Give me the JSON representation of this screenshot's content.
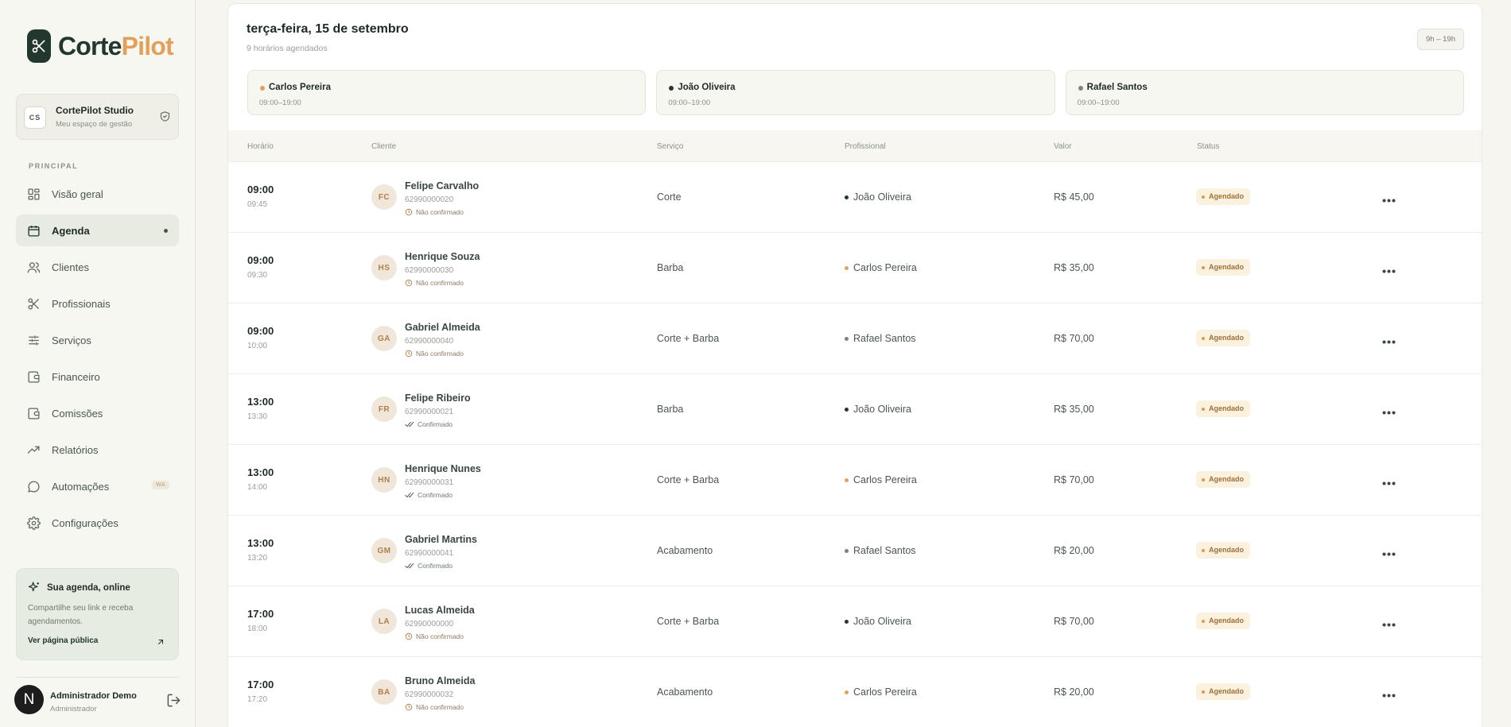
{
  "brand": {
    "name_a": "Corte",
    "name_b": "Pilot",
    "accent": "#e3a05b",
    "dark": "#22382e"
  },
  "studio": {
    "initials": "CS",
    "name": "CortePilot Studio",
    "subtitle": "Meu espaço de gestão"
  },
  "sidebar": {
    "section": "PRINCIPAL",
    "items": [
      {
        "label": "Visão geral",
        "icon": "grid-icon"
      },
      {
        "label": "Agenda",
        "icon": "calendar-icon",
        "active": true
      },
      {
        "label": "Clientes",
        "icon": "users-icon"
      },
      {
        "label": "Profissionais",
        "icon": "scissors-icon"
      },
      {
        "label": "Serviços",
        "icon": "sliders-icon"
      },
      {
        "label": "Financeiro",
        "icon": "wallet-icon"
      },
      {
        "label": "Comissões",
        "icon": "wallet-icon"
      },
      {
        "label": "Relatórios",
        "icon": "trend-icon"
      },
      {
        "label": "Automações",
        "icon": "chat-icon",
        "badge": "WA"
      },
      {
        "label": "Configurações",
        "icon": "gear-icon"
      }
    ]
  },
  "promo": {
    "title": "Sua agenda, online",
    "text": "Compartilhe seu link e receba agendamentos.",
    "link": "Ver página pública"
  },
  "user": {
    "initial": "N",
    "name": "Administrador Demo",
    "role": "Administrador"
  },
  "day": {
    "title": "terça-feira, 15 de setembro",
    "subtitle": "9 horários agendados",
    "hours": "9h – 19h"
  },
  "professionals": [
    {
      "name": "Carlos Pereira",
      "hours": "09:00–19:00",
      "color": "#e3a05b"
    },
    {
      "name": "João Oliveira",
      "hours": "09:00–19:00",
      "color": "#22382e"
    },
    {
      "name": "Rafael Santos",
      "hours": "09:00–19:00",
      "color": "#7b847e"
    }
  ],
  "table": {
    "headers": {
      "time": "Horário",
      "client": "Cliente",
      "service": "Serviço",
      "pro": "Profissional",
      "value": "Valor",
      "status": "Status"
    },
    "rows": [
      {
        "start": "09:00",
        "end": "09:45",
        "initials": "FC",
        "name": "Felipe Carvalho",
        "phone": "62990000020",
        "confirmed": false,
        "conf_label": "Não confirmado",
        "service": "Corte",
        "pro": "João Oliveira",
        "pro_color": "#22382e",
        "value": "R$ 45,00",
        "status": "Agendado"
      },
      {
        "start": "09:00",
        "end": "09:30",
        "initials": "HS",
        "name": "Henrique Souza",
        "phone": "62990000030",
        "confirmed": false,
        "conf_label": "Não confirmado",
        "service": "Barba",
        "pro": "Carlos Pereira",
        "pro_color": "#e3a05b",
        "value": "R$ 35,00",
        "status": "Agendado"
      },
      {
        "start": "09:00",
        "end": "10:00",
        "initials": "GA",
        "name": "Gabriel Almeida",
        "phone": "62990000040",
        "confirmed": false,
        "conf_label": "Não confirmado",
        "service": "Corte + Barba",
        "pro": "Rafael Santos",
        "pro_color": "#7b847e",
        "value": "R$ 70,00",
        "status": "Agendado"
      },
      {
        "start": "13:00",
        "end": "13:30",
        "initials": "FR",
        "name": "Felipe Ribeiro",
        "phone": "62990000021",
        "confirmed": true,
        "conf_label": "Confirmado",
        "service": "Barba",
        "pro": "João Oliveira",
        "pro_color": "#22382e",
        "value": "R$ 35,00",
        "status": "Agendado"
      },
      {
        "start": "13:00",
        "end": "14:00",
        "initials": "HN",
        "name": "Henrique Nunes",
        "phone": "62990000031",
        "confirmed": true,
        "conf_label": "Confirmado",
        "service": "Corte + Barba",
        "pro": "Carlos Pereira",
        "pro_color": "#e3a05b",
        "value": "R$ 70,00",
        "status": "Agendado"
      },
      {
        "start": "13:00",
        "end": "13:20",
        "initials": "GM",
        "name": "Gabriel Martins",
        "phone": "62990000041",
        "confirmed": true,
        "conf_label": "Confirmado",
        "service": "Acabamento",
        "pro": "Rafael Santos",
        "pro_color": "#7b847e",
        "value": "R$ 20,00",
        "status": "Agendado"
      },
      {
        "start": "17:00",
        "end": "18:00",
        "initials": "LA",
        "name": "Lucas Almeida",
        "phone": "62990000000",
        "confirmed": false,
        "conf_label": "Não confirmado",
        "service": "Corte + Barba",
        "pro": "João Oliveira",
        "pro_color": "#22382e",
        "value": "R$ 70,00",
        "status": "Agendado"
      },
      {
        "start": "17:00",
        "end": "17:20",
        "initials": "BA",
        "name": "Bruno Almeida",
        "phone": "62990000032",
        "confirmed": false,
        "conf_label": "Não confirmado",
        "service": "Acabamento",
        "pro": "Carlos Pereira",
        "pro_color": "#e3a05b",
        "value": "R$ 20,00",
        "status": "Agendado"
      }
    ]
  }
}
